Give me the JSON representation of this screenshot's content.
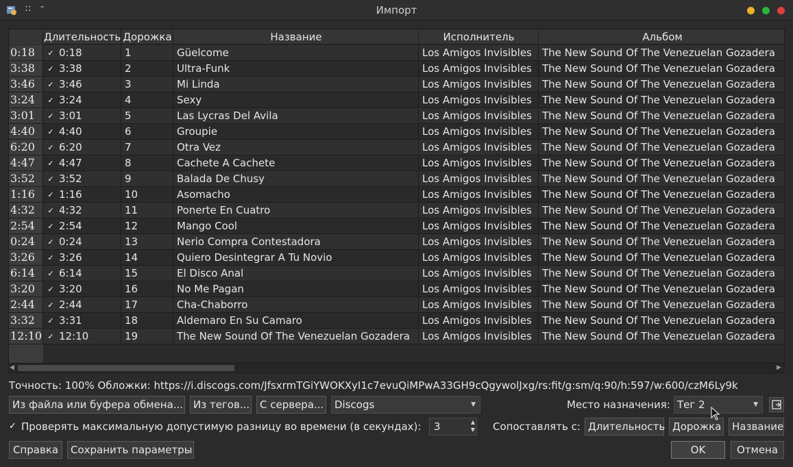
{
  "window": {
    "title": "Импорт",
    "menu_dots": "::",
    "menu_minus": "-"
  },
  "table": {
    "columns": [
      "Длительность",
      "Дорожка",
      "Название",
      "Исполнитель",
      "Альбом"
    ],
    "rows": [
      {
        "header": "0:18",
        "checked": true,
        "duration": "0:18",
        "track": "1",
        "title": "Güelcome",
        "artist": "Los Amigos Invisibles",
        "album": "The New Sound Of The Venezuelan Gozadera"
      },
      {
        "header": "3:38",
        "checked": true,
        "duration": "3:38",
        "track": "2",
        "title": "Ultra-Funk",
        "artist": "Los Amigos Invisibles",
        "album": "The New Sound Of The Venezuelan Gozadera"
      },
      {
        "header": "3:46",
        "checked": true,
        "duration": "3:46",
        "track": "3",
        "title": "Mi Linda",
        "artist": "Los Amigos Invisibles",
        "album": "The New Sound Of The Venezuelan Gozadera"
      },
      {
        "header": "3:24",
        "checked": true,
        "duration": "3:24",
        "track": "4",
        "title": "Sexy",
        "artist": "Los Amigos Invisibles",
        "album": "The New Sound Of The Venezuelan Gozadera"
      },
      {
        "header": "3:01",
        "checked": true,
        "duration": "3:01",
        "track": "5",
        "title": "Las Lycras Del Avila",
        "artist": "Los Amigos Invisibles",
        "album": "The New Sound Of The Venezuelan Gozadera"
      },
      {
        "header": "4:40",
        "checked": true,
        "duration": "4:40",
        "track": "6",
        "title": "Groupie",
        "artist": "Los Amigos Invisibles",
        "album": "The New Sound Of The Venezuelan Gozadera"
      },
      {
        "header": "6:20",
        "checked": true,
        "duration": "6:20",
        "track": "7",
        "title": "Otra Vez",
        "artist": "Los Amigos Invisibles",
        "album": "The New Sound Of The Venezuelan Gozadera"
      },
      {
        "header": "4:47",
        "checked": true,
        "duration": "4:47",
        "track": "8",
        "title": "Cachete A Cachete",
        "artist": "Los Amigos Invisibles",
        "album": "The New Sound Of The Venezuelan Gozadera"
      },
      {
        "header": "3:52",
        "checked": true,
        "duration": "3:52",
        "track": "9",
        "title": "Balada De Chusy",
        "artist": "Los Amigos Invisibles",
        "album": "The New Sound Of The Venezuelan Gozadera"
      },
      {
        "header": "1:16",
        "checked": true,
        "duration": "1:16",
        "track": "10",
        "title": "Asomacho",
        "artist": "Los Amigos Invisibles",
        "album": "The New Sound Of The Venezuelan Gozadera"
      },
      {
        "header": "4:32",
        "checked": true,
        "duration": "4:32",
        "track": "11",
        "title": "Ponerte En Cuatro",
        "artist": "Los Amigos Invisibles",
        "album": "The New Sound Of The Venezuelan Gozadera"
      },
      {
        "header": "2:54",
        "checked": true,
        "duration": "2:54",
        "track": "12",
        "title": "Mango Cool",
        "artist": "Los Amigos Invisibles",
        "album": "The New Sound Of The Venezuelan Gozadera"
      },
      {
        "header": "0:24",
        "checked": true,
        "duration": "0:24",
        "track": "13",
        "title": "Nerio Compra Contestadora",
        "artist": "Los Amigos Invisibles",
        "album": "The New Sound Of The Venezuelan Gozadera"
      },
      {
        "header": "3:26",
        "checked": true,
        "duration": "3:26",
        "track": "14",
        "title": "Quiero Desintegrar A Tu Novio",
        "artist": "Los Amigos Invisibles",
        "album": "The New Sound Of The Venezuelan Gozadera"
      },
      {
        "header": "6:14",
        "checked": true,
        "duration": "6:14",
        "track": "15",
        "title": "El Disco Anal",
        "artist": "Los Amigos Invisibles",
        "album": "The New Sound Of The Venezuelan Gozadera"
      },
      {
        "header": "3:20",
        "checked": true,
        "duration": "3:20",
        "track": "16",
        "title": "No Me Pagan",
        "artist": "Los Amigos Invisibles",
        "album": "The New Sound Of The Venezuelan Gozadera"
      },
      {
        "header": "2:44",
        "checked": true,
        "duration": "2:44",
        "track": "17",
        "title": "Cha-Chaborro",
        "artist": "Los Amigos Invisibles",
        "album": "The New Sound Of The Venezuelan Gozadera"
      },
      {
        "header": "3:32",
        "checked": true,
        "duration": "3:31",
        "track": "18",
        "title": "Aldemaro En Su Camaro",
        "artist": "Los Amigos Invisibles",
        "album": "The New Sound Of The Venezuelan Gozadera"
      },
      {
        "header": "12:10",
        "checked": true,
        "duration": "12:10",
        "track": "19",
        "title": "The New Sound Of The Venezuelan Gozadera",
        "artist": "Los Amigos Invisibles",
        "album": "The New Sound Of The Venezuelan Gozadera"
      }
    ]
  },
  "info_line": "Точность: 100% Обложки: https://i.discogs.com/JfsxrmTGiYWOKXyI1c7evuQiMPwA33GH9cQgywolJxg/rs:fit/g:sm/q:90/h:597/w:600/czM6Ly9k",
  "buttons": {
    "from_file": "Из файла или буфера обмена...",
    "from_tags": "Из тегов...",
    "from_server": "С сервера...",
    "help": "Справка",
    "save_settings": "Сохранить параметры",
    "ok": "OK",
    "cancel": "Отмена",
    "match_duration": "Длительность",
    "match_track": "Дорожка",
    "match_title": "Название"
  },
  "server_select": "Discogs",
  "destination_label": "Место назначения:",
  "destination_value": "Тег 2",
  "check_time_diff": {
    "checked": true,
    "label": "Проверять максимальную допустимую разницу во времени (в секундах):",
    "value": "3"
  },
  "match_label": "Сопоставлять с:"
}
